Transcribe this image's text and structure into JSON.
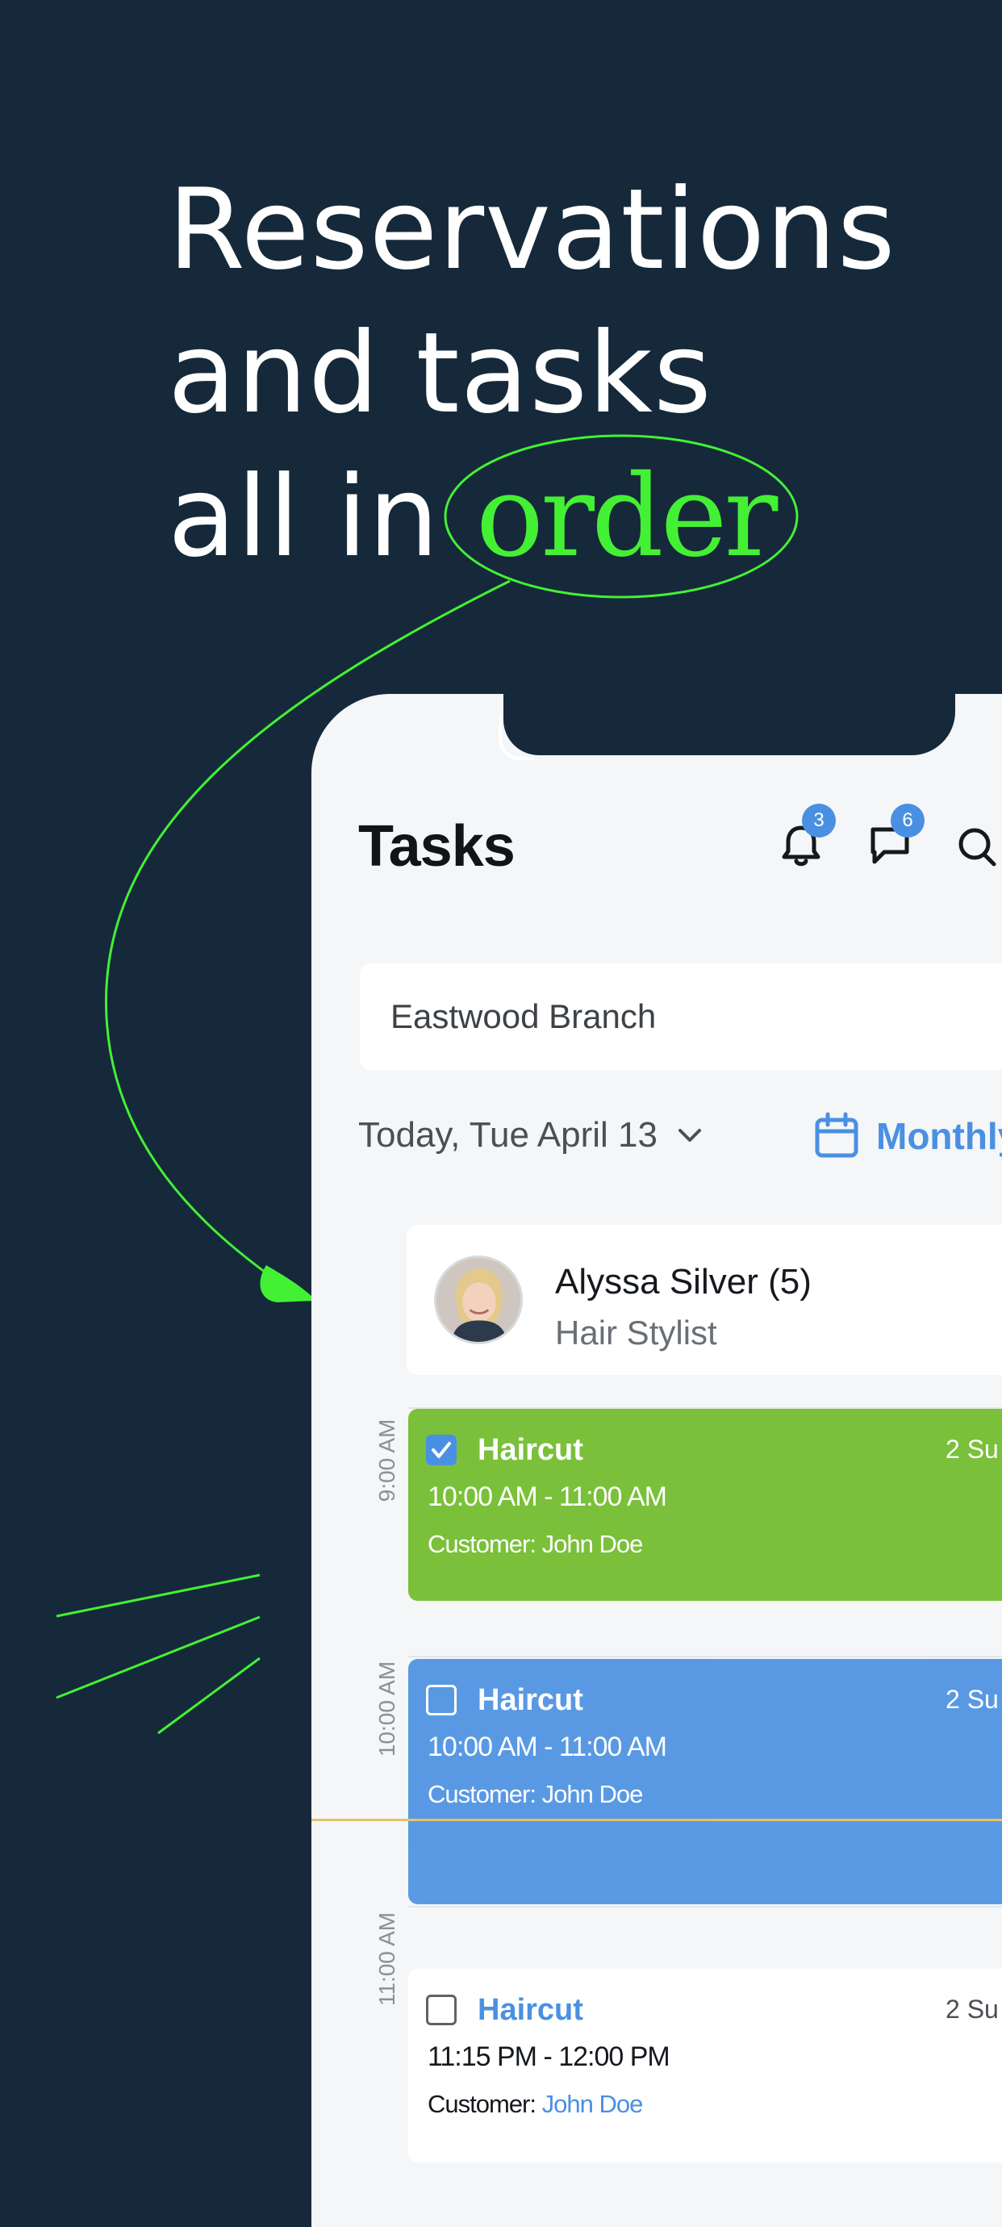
{
  "headline": {
    "line1": "Reservations",
    "line2": "and tasks",
    "line3_prefix": "all in ",
    "accent_word": "order"
  },
  "colors": {
    "background": "#15293a",
    "accent": "#44f034",
    "primary_blue": "#4a90e2",
    "task_done_green": "#7ac03a",
    "task_active_blue": "#5698e4"
  },
  "app": {
    "title": "Tasks",
    "notifications": {
      "icon": "bell-icon",
      "count": "3"
    },
    "messages": {
      "icon": "chat-icon",
      "count": "6"
    },
    "search_icon": "search-icon",
    "branch": "Eastwood Branch",
    "date_label": "Today, Tue April 13",
    "view_label": "Monthly"
  },
  "staff": {
    "name": "Alyssa Silver (5)",
    "role": "Hair Stylist"
  },
  "time_slots": [
    "9:00 AM",
    "10:00 AM",
    "11:00 AM"
  ],
  "tasks": [
    {
      "name": "Haircut",
      "time": "10:00 AM - 11:00 AM",
      "customer_prefix": "Customer: ",
      "customer": "John Doe",
      "right_text": "2 Su",
      "checked": true
    },
    {
      "name": "Haircut",
      "time": "10:00 AM - 11:00 AM",
      "customer_prefix": "Customer: ",
      "customer": "John Doe",
      "right_text": "2 Su",
      "checked": false
    },
    {
      "name": "Haircut",
      "time": "11:15 PM - 12:00 PM",
      "customer_prefix": "Customer: ",
      "customer": "John Doe",
      "right_text": "2 Su",
      "checked": false
    }
  ]
}
